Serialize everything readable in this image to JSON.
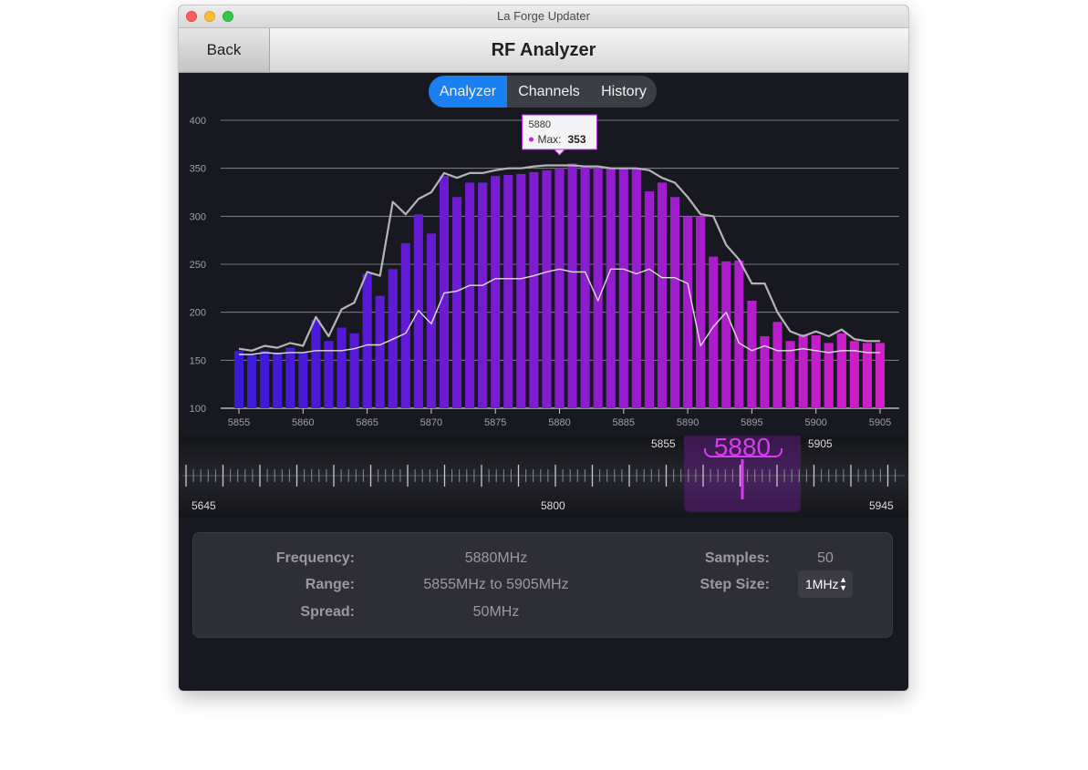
{
  "window": {
    "title": "La Forge Updater"
  },
  "navbar": {
    "back_label": "Back",
    "title": "RF Analyzer"
  },
  "tabs": [
    {
      "label": "Analyzer",
      "active": true
    },
    {
      "label": "Channels",
      "active": false
    },
    {
      "label": "History",
      "active": false
    }
  ],
  "chart_data": {
    "type": "bar",
    "x": [
      5855,
      5856,
      5857,
      5858,
      5859,
      5860,
      5861,
      5862,
      5863,
      5864,
      5865,
      5866,
      5867,
      5868,
      5869,
      5870,
      5871,
      5872,
      5873,
      5874,
      5875,
      5876,
      5877,
      5878,
      5879,
      5880,
      5881,
      5882,
      5883,
      5884,
      5885,
      5886,
      5887,
      5888,
      5889,
      5890,
      5891,
      5892,
      5893,
      5894,
      5895,
      5896,
      5897,
      5898,
      5899,
      5900,
      5901,
      5902,
      5903,
      5904,
      5905
    ],
    "xticks": [
      5855,
      5860,
      5865,
      5870,
      5875,
      5880,
      5885,
      5890,
      5895,
      5900,
      5905
    ],
    "yticks": [
      100,
      150,
      200,
      250,
      300,
      350,
      400
    ],
    "ylim": [
      100,
      400
    ],
    "series": [
      {
        "values": [
          160,
          155,
          160,
          158,
          163,
          158,
          192,
          170,
          184,
          178,
          240,
          217,
          245,
          272,
          302,
          282,
          342,
          320,
          335,
          335,
          342,
          343,
          344,
          346,
          348,
          350,
          355,
          352,
          350,
          350,
          350,
          350,
          326,
          335,
          320,
          300,
          300,
          258,
          253,
          254,
          212,
          175,
          190,
          170,
          177,
          176,
          168,
          178,
          170,
          168,
          168
        ]
      },
      {
        "values": [
          162,
          160,
          165,
          163,
          168,
          165,
          195,
          175,
          203,
          210,
          242,
          238,
          315,
          302,
          318,
          325,
          345,
          340,
          345,
          345,
          348,
          350,
          350,
          352,
          353,
          353,
          353,
          352,
          352,
          350,
          350,
          350,
          348,
          340,
          335,
          320,
          302,
          300,
          270,
          255,
          230,
          230,
          200,
          180,
          175,
          180,
          175,
          182,
          172,
          170,
          170
        ]
      },
      {
        "values": [
          156,
          156,
          158,
          157,
          158,
          158,
          160,
          160,
          160,
          162,
          166,
          166,
          172,
          178,
          202,
          188,
          220,
          222,
          228,
          228,
          235,
          235,
          235,
          238,
          242,
          245,
          242,
          242,
          212,
          245,
          245,
          240,
          245,
          236,
          236,
          230,
          165,
          185,
          200,
          168,
          160,
          165,
          160,
          160,
          162,
          160,
          158,
          160,
          160,
          158,
          158
        ]
      }
    ],
    "tooltip": {
      "x_label": "5880",
      "series_label": "Max:",
      "value": "353"
    },
    "colors": {
      "bar_start": "#3a1ad8",
      "bar_end": "#d21ec8",
      "max_line": "#b4b4b8",
      "avg_line": "#dcdce0"
    }
  },
  "dial": {
    "center": "5880",
    "window_min": "5855",
    "window_max": "5905",
    "scale_min": "5645",
    "scale_mid": "5800",
    "scale_max": "5945",
    "accent_color": "#d93bf0"
  },
  "info": {
    "frequency_label": "Frequency:",
    "frequency_value": "5880MHz",
    "range_label": "Range:",
    "range_value": "5855MHz to 5905MHz",
    "spread_label": "Spread:",
    "spread_value": "50MHz",
    "samples_label": "Samples:",
    "samples_value": "50",
    "step_label": "Step Size:",
    "step_value": "1MHz"
  }
}
